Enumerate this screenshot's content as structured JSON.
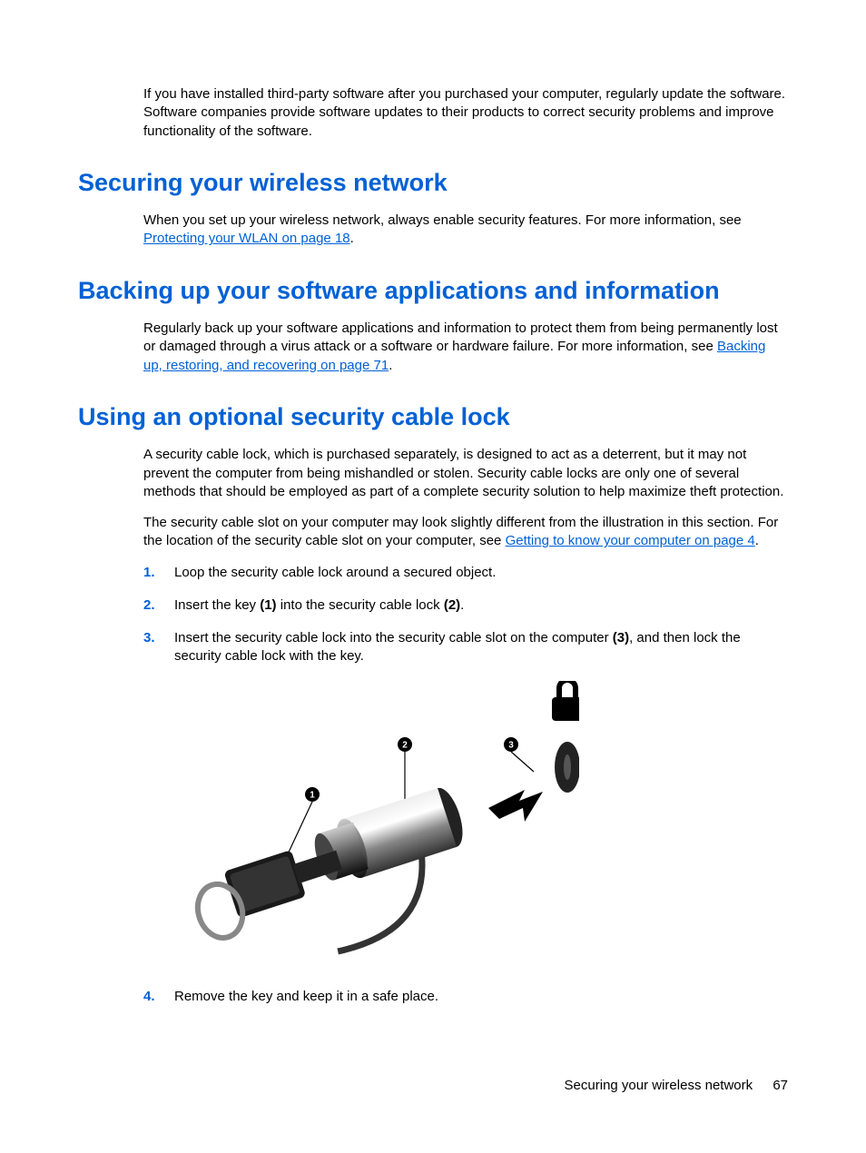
{
  "intro_paragraph": "If you have installed third-party software after you purchased your computer, regularly update the software. Software companies provide software updates to their products to correct security problems and improve functionality of the software.",
  "section1": {
    "heading": "Securing your wireless network",
    "body_pre": "When you set up your wireless network, always enable security features. For more information, see ",
    "link_text": "Protecting your WLAN on page 18",
    "body_post": "."
  },
  "section2": {
    "heading": "Backing up your software applications and information",
    "body_pre": "Regularly back up your software applications and information to protect them from being permanently lost or damaged through a virus attack or a software or hardware failure. For more information, see ",
    "link_text": "Backing up, restoring, and recovering on page 71",
    "body_post": "."
  },
  "section3": {
    "heading": "Using an optional security cable lock",
    "para1": "A security cable lock, which is purchased separately, is designed to act as a deterrent, but it may not prevent the computer from being mishandled or stolen. Security cable locks are only one of several methods that should be employed as part of a complete security solution to help maximize theft protection.",
    "para2_pre": "The security cable slot on your computer may look slightly different from the illustration in this section. For the location of the security cable slot on your computer, see ",
    "para2_link": "Getting to know your computer on page 4",
    "para2_post": ".",
    "steps": [
      {
        "num": "1.",
        "text": "Loop the security cable lock around a secured object."
      },
      {
        "num": "2.",
        "pre": "Insert the key ",
        "b1": "(1)",
        "mid": " into the security cable lock ",
        "b2": "(2)",
        "post": "."
      },
      {
        "num": "3.",
        "pre": "Insert the security cable lock into the security cable slot on the computer ",
        "b1": "(3)",
        "post": ", and then lock the security cable lock with the key."
      },
      {
        "num": "4.",
        "text": "Remove the key and keep it in a safe place."
      }
    ],
    "callouts": {
      "c1": "1",
      "c2": "2",
      "c3": "3"
    }
  },
  "footer": {
    "title": "Securing your wireless network",
    "page": "67"
  }
}
